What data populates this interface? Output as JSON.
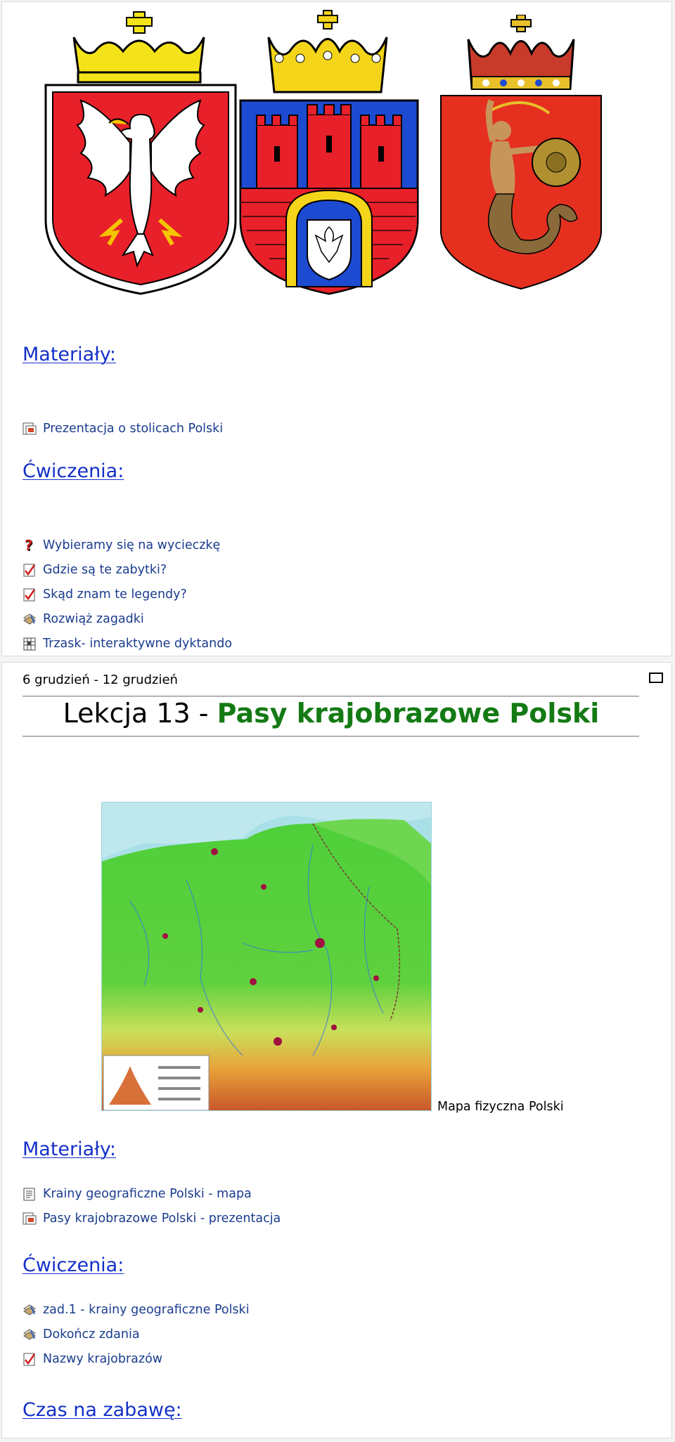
{
  "panel1": {
    "crests": [
      {
        "name": "Herb Polski (orzeł)",
        "colors": {
          "field": "#e8202a",
          "crown": "#f5e31a",
          "eagle": "#ffffff",
          "beak": "#f5c400"
        }
      },
      {
        "name": "Herb Krakowa",
        "colors": {
          "field": "#e8202a",
          "crown": "#f5d51a",
          "gate": "#1c4bd2",
          "towers": "#e8202a"
        }
      },
      {
        "name": "Herb Warszawy (Syrenka)",
        "colors": {
          "field": "#e5301f",
          "crown": "#c83b2a",
          "body": "#c7955a",
          "tail": "#8a6a3a",
          "shield": "#b09030"
        }
      }
    ],
    "materials_heading": "Materiały:",
    "materials": [
      {
        "label": "Prezentacja o stolicach Polski",
        "icon": "presentation-icon"
      }
    ],
    "exercises_heading": "Ćwiczenia:",
    "exercises": [
      {
        "label": "Wybieramy się na wycieczkę",
        "icon": "question-icon"
      },
      {
        "label": "Gdzie są te zabytki?",
        "icon": "checklist-icon"
      },
      {
        "label": "Skąd znam te legendy?",
        "icon": "checklist-icon"
      },
      {
        "label": "Rozwiąż zagadki",
        "icon": "puzzle-icon"
      },
      {
        "label": "Trzask- interaktywne dyktando",
        "icon": "crossword-icon"
      }
    ]
  },
  "panel2": {
    "dates": "6 grudzień - 12 grudzień",
    "title_prefix": "Lekcja 13 - ",
    "title_main": "Pasy krajobrazowe Polski",
    "map_caption": "Mapa fizyczna Polski",
    "materials_heading": "Materiały:",
    "materials": [
      {
        "label": "Krainy geograficzne Polski - mapa",
        "icon": "document-icon"
      },
      {
        "label": "Pasy krajobrazowe Polski - prezentacja",
        "icon": "presentation-icon"
      }
    ],
    "exercises_heading": "Ćwiczenia:",
    "exercises": [
      {
        "label": "zad.1 - krainy geograficzne Polski",
        "icon": "puzzle-icon"
      },
      {
        "label": "Dokończ zdania",
        "icon": "puzzle-icon"
      },
      {
        "label": "Nazwy krajobrazów",
        "icon": "checklist-icon"
      }
    ],
    "fun_heading": "Czas na zabawę:"
  },
  "colors": {
    "link": "#1a3c8e",
    "heading": "#1430c8",
    "lesson_green": "#147a14"
  }
}
